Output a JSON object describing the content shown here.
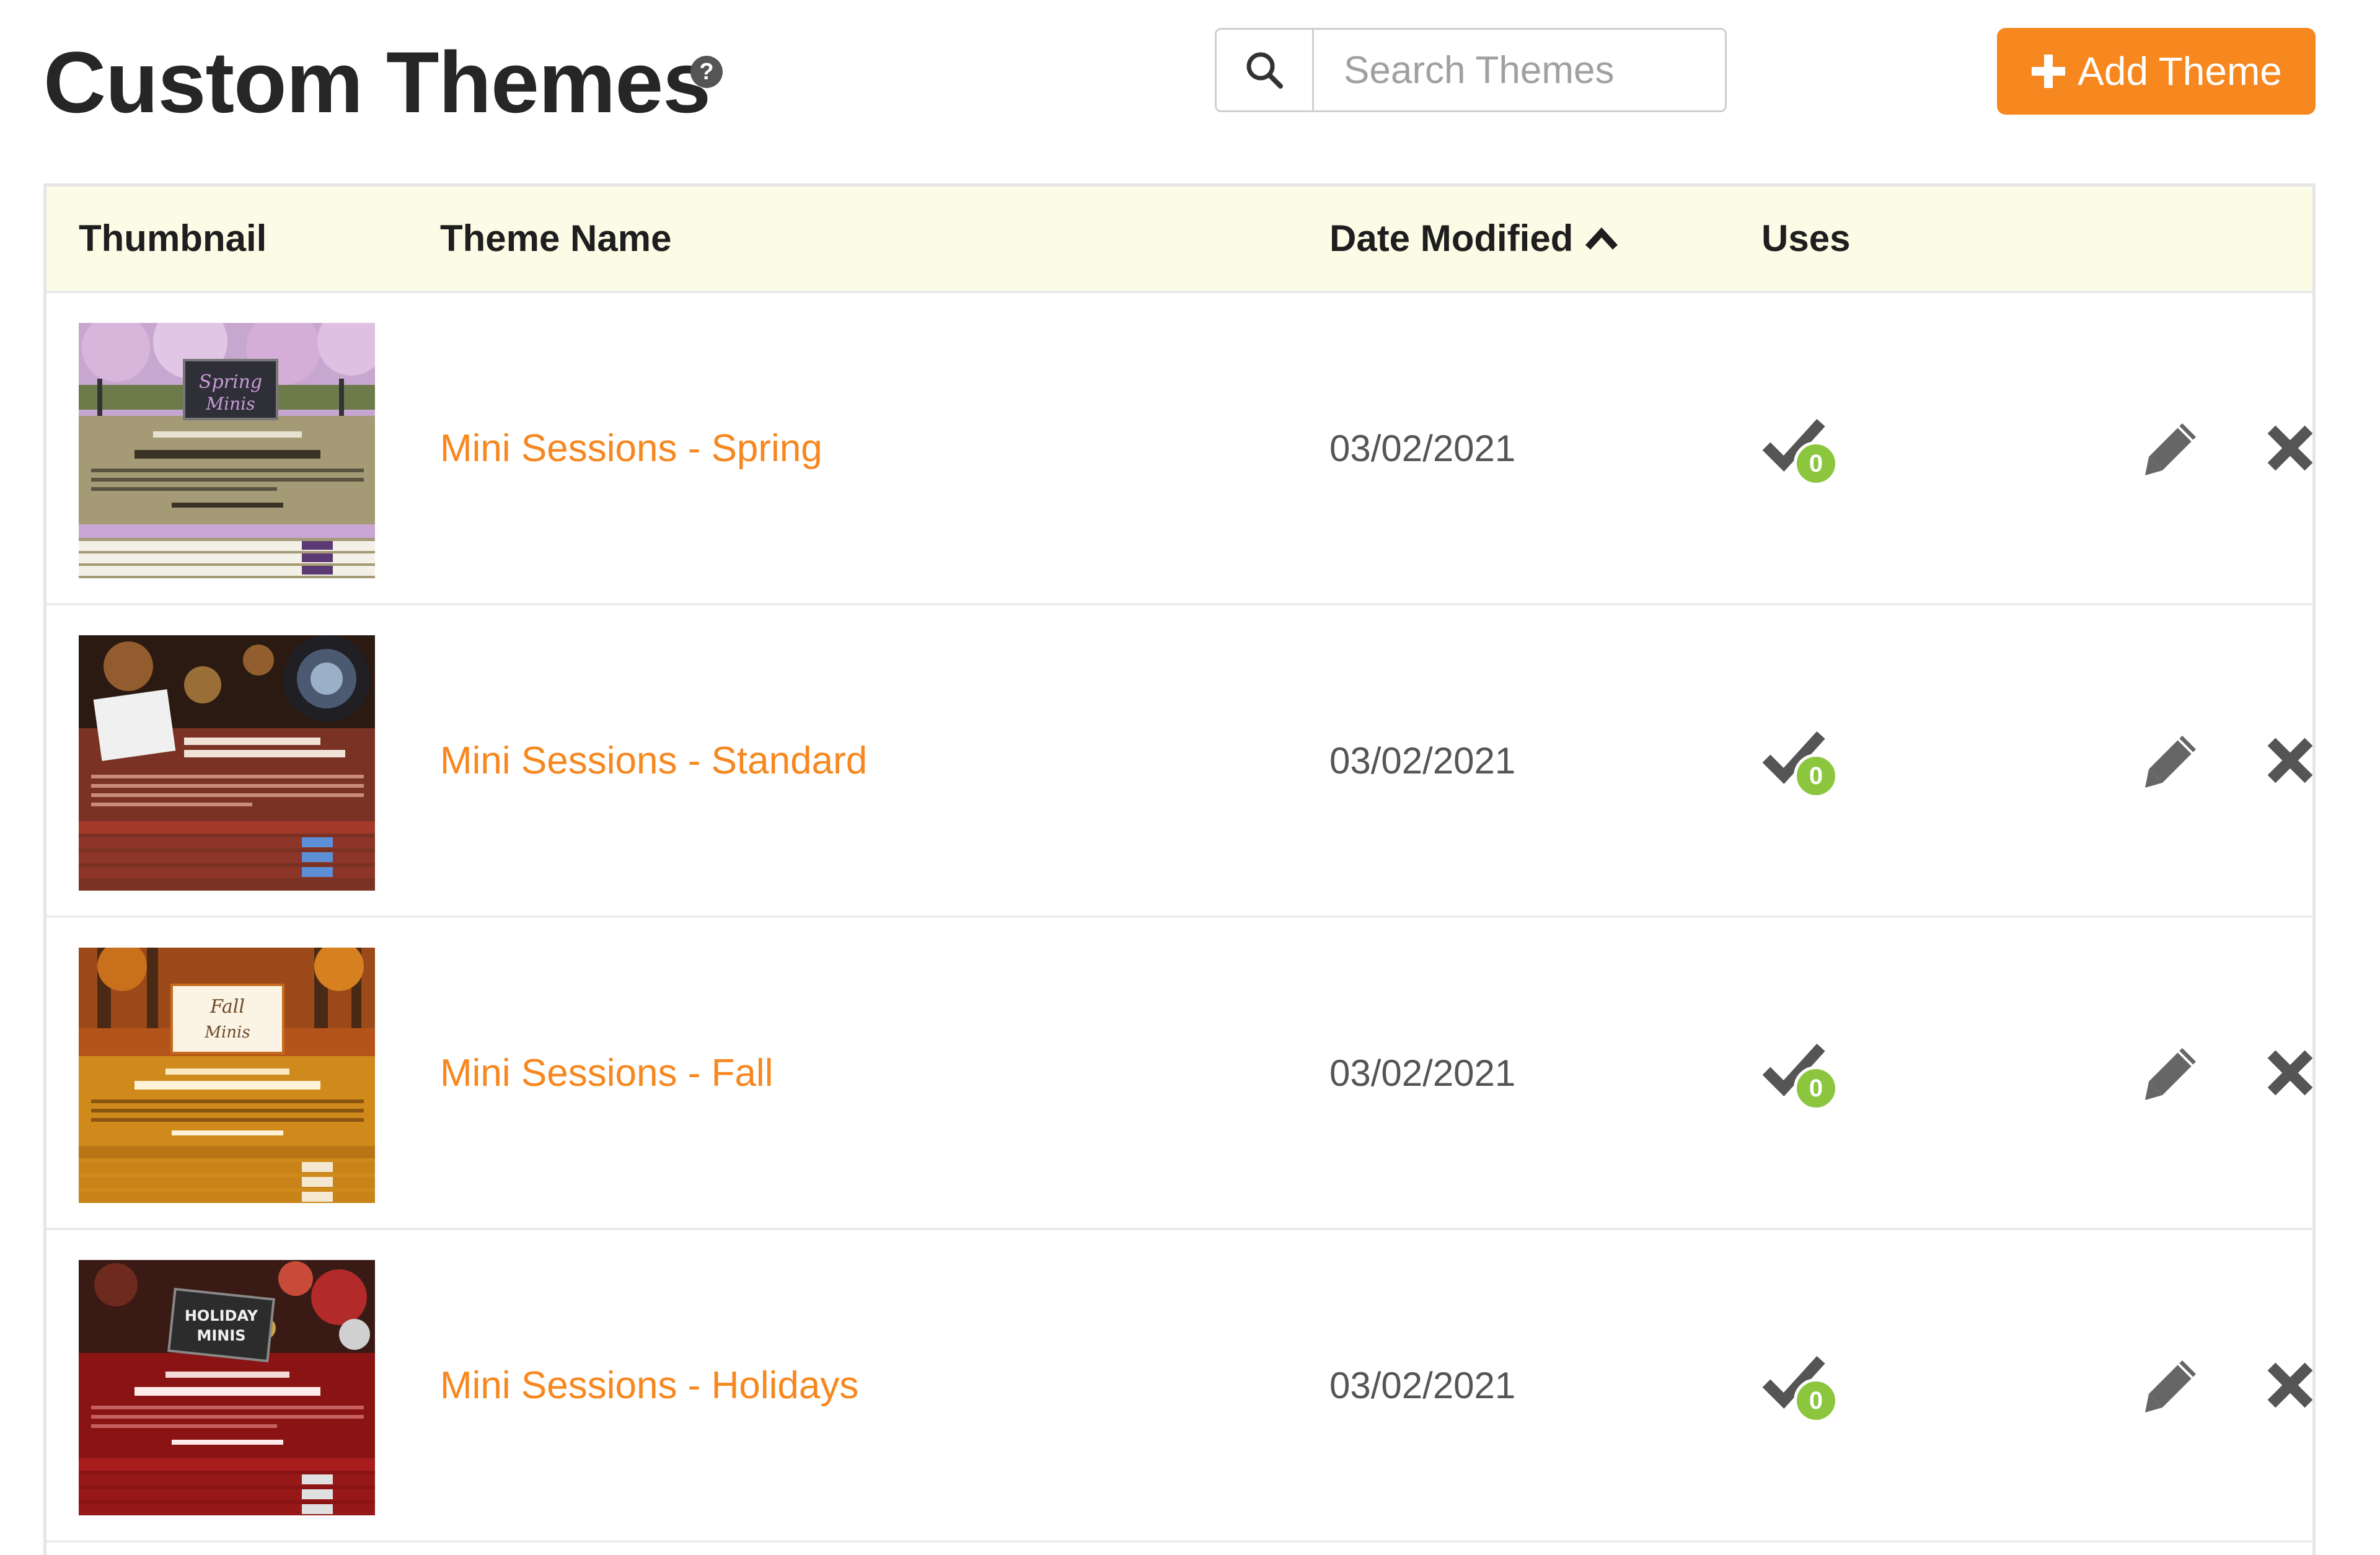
{
  "header": {
    "title": "Custom Themes",
    "help_glyph": "?",
    "search_placeholder": "Search Themes",
    "add_button_label": "Add Theme",
    "accent_color": "#f7871f"
  },
  "table": {
    "columns": {
      "thumbnail": "Thumbnail",
      "name": "Theme Name",
      "date": "Date Modified",
      "uses": "Uses"
    },
    "sort": {
      "column": "Date Modified",
      "direction": "ascending",
      "icon": "chevron-up-icon"
    },
    "rows": [
      {
        "name": "Mini Sessions - Spring",
        "date": "03/02/2021",
        "uses": "0",
        "thumbnail_theme": "spring"
      },
      {
        "name": "Mini Sessions - Standard",
        "date": "03/02/2021",
        "uses": "0",
        "thumbnail_theme": "standard"
      },
      {
        "name": "Mini Sessions - Fall",
        "date": "03/02/2021",
        "uses": "0",
        "thumbnail_theme": "fall"
      },
      {
        "name": "Mini Sessions - Holidays",
        "date": "03/02/2021",
        "uses": "0",
        "thumbnail_theme": "holidays"
      }
    ],
    "row_icons": {
      "uses": "check-icon",
      "edit": "pencil-icon",
      "delete": "close-icon"
    },
    "uses_badge_color": "#8cc63f"
  }
}
